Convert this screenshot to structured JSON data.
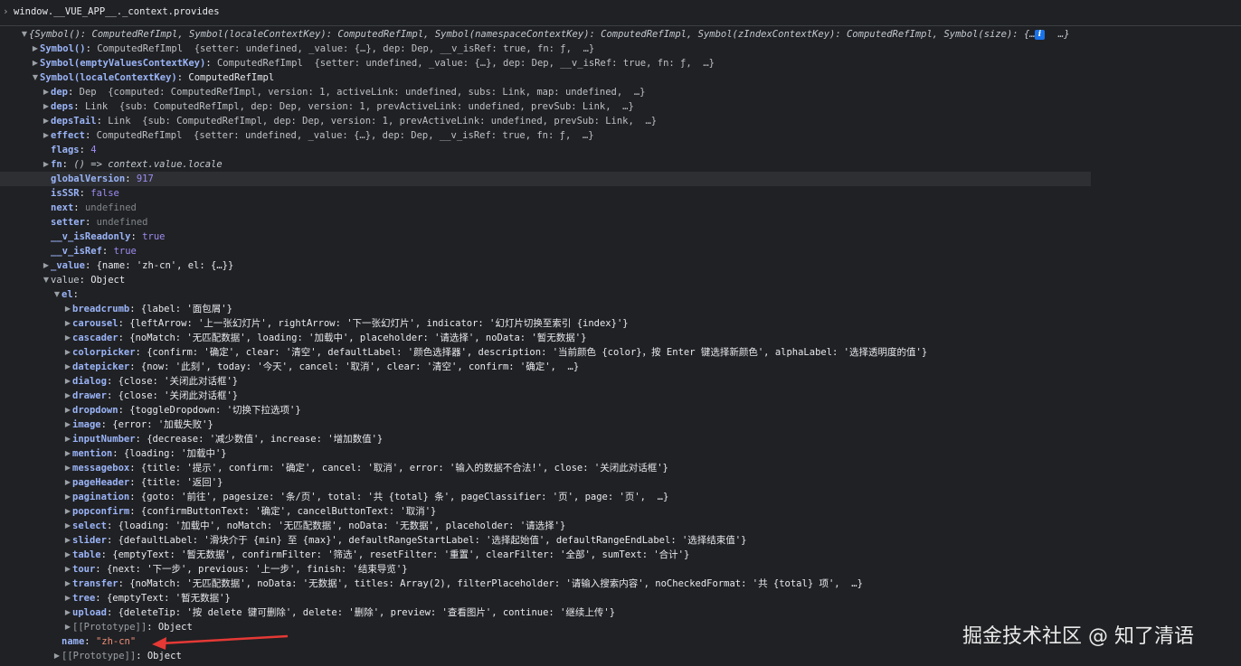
{
  "input": {
    "prompt": "›",
    "command": "window.__VUE_APP__._context.provides"
  },
  "rows": [
    {
      "d": 0,
      "t": "open",
      "k": "",
      "v": "{Symbol(): ComputedRefImpl, Symbol(localeContextKey): ComputedRefImpl, Symbol(namespaceContextKey): ComputedRefImpl, Symbol(zIndexContextKey): ComputedRefImpl, Symbol(size): {…},  …}",
      "vc": "it"
    },
    {
      "d": 1,
      "t": "closed",
      "k": "Symbol()",
      "v": "ComputedRefImpl  {setter: undefined, _value: {…}, dep: Dep, __v_isRef: true, fn: ƒ,  …}",
      "vc": "pre"
    },
    {
      "d": 1,
      "t": "closed",
      "k": "Symbol(emptyValuesContextKey)",
      "v": "ComputedRefImpl  {setter: undefined, _value: {…}, dep: Dep, __v_isRef: true, fn: ƒ,  …}",
      "vc": "pre"
    },
    {
      "d": 1,
      "t": "open",
      "k": "Symbol(localeContextKey)",
      "v": "ComputedRefImpl",
      "vc": "obj"
    },
    {
      "d": 2,
      "t": "closed",
      "k": "dep",
      "v": "Dep  {computed: ComputedRefImpl, version: 1, activeLink: undefined, subs: Link, map: undefined,  …}",
      "vc": "pre"
    },
    {
      "d": 2,
      "t": "closed",
      "k": "deps",
      "v": "Link  {sub: ComputedRefImpl, dep: Dep, version: 1, prevActiveLink: undefined, prevSub: Link,  …}",
      "vc": "pre"
    },
    {
      "d": 2,
      "t": "closed",
      "k": "depsTail",
      "v": "Link  {sub: ComputedRefImpl, dep: Dep, version: 1, prevActiveLink: undefined, prevSub: Link,  …}",
      "vc": "pre"
    },
    {
      "d": 2,
      "t": "closed",
      "k": "effect",
      "v": "ComputedRefImpl  {setter: undefined, _value: {…}, dep: Dep, __v_isRef: true, fn: ƒ,  …}",
      "vc": "pre"
    },
    {
      "d": 2,
      "t": "none",
      "k": "flags",
      "v": "4",
      "vc": "num"
    },
    {
      "d": 2,
      "t": "closed",
      "k": "fn",
      "v": "() => context.value.locale",
      "vc": "it"
    },
    {
      "d": 2,
      "t": "none",
      "k": "globalVersion",
      "v": "917",
      "vc": "num",
      "hl": true
    },
    {
      "d": 2,
      "t": "none",
      "k": "isSSR",
      "v": "false",
      "vc": "kw"
    },
    {
      "d": 2,
      "t": "none",
      "k": "next",
      "v": "undefined",
      "vc": "und"
    },
    {
      "d": 2,
      "t": "none",
      "k": "setter",
      "v": "undefined",
      "vc": "und"
    },
    {
      "d": 2,
      "t": "none",
      "k": "__v_isReadonly",
      "v": "true",
      "vc": "kw"
    },
    {
      "d": 2,
      "t": "none",
      "k": "__v_isRef",
      "v": "true",
      "vc": "kw"
    },
    {
      "d": 2,
      "t": "closed",
      "k": "_value",
      "v": "{name: 'zh-cn', el: {…}}",
      "vc": "obj"
    },
    {
      "d": 2,
      "t": "open",
      "k": "value",
      "v": "Object",
      "vc": "obj",
      "kc": "plain"
    },
    {
      "d": 3,
      "t": "open",
      "k": "el",
      "v": "",
      "vc": "obj"
    },
    {
      "d": 4,
      "t": "closed",
      "k": "breadcrumb",
      "v": "{label: '面包屑'}",
      "vc": "obj"
    },
    {
      "d": 4,
      "t": "closed",
      "k": "carousel",
      "v": "{leftArrow: '上一张幻灯片', rightArrow: '下一张幻灯片', indicator: '幻灯片切换至索引 {index}'}",
      "vc": "obj"
    },
    {
      "d": 4,
      "t": "closed",
      "k": "cascader",
      "v": "{noMatch: '无匹配数据', loading: '加载中', placeholder: '请选择', noData: '暂无数据'}",
      "vc": "obj"
    },
    {
      "d": 4,
      "t": "closed",
      "k": "colorpicker",
      "v": "{confirm: '确定', clear: '清空', defaultLabel: '颜色选择器', description: '当前颜色 {color}，按 Enter 键选择新颜色', alphaLabel: '选择透明度的值'}",
      "vc": "obj"
    },
    {
      "d": 4,
      "t": "closed",
      "k": "datepicker",
      "v": "{now: '此刻', today: '今天', cancel: '取消', clear: '清空', confirm: '确定',  …}",
      "vc": "obj"
    },
    {
      "d": 4,
      "t": "closed",
      "k": "dialog",
      "v": "{close: '关闭此对话框'}",
      "vc": "obj"
    },
    {
      "d": 4,
      "t": "closed",
      "k": "drawer",
      "v": "{close: '关闭此对话框'}",
      "vc": "obj"
    },
    {
      "d": 4,
      "t": "closed",
      "k": "dropdown",
      "v": "{toggleDropdown: '切换下拉选项'}",
      "vc": "obj"
    },
    {
      "d": 4,
      "t": "closed",
      "k": "image",
      "v": "{error: '加载失败'}",
      "vc": "obj"
    },
    {
      "d": 4,
      "t": "closed",
      "k": "inputNumber",
      "v": "{decrease: '减少数值', increase: '增加数值'}",
      "vc": "obj"
    },
    {
      "d": 4,
      "t": "closed",
      "k": "mention",
      "v": "{loading: '加载中'}",
      "vc": "obj"
    },
    {
      "d": 4,
      "t": "closed",
      "k": "messagebox",
      "v": "{title: '提示', confirm: '确定', cancel: '取消', error: '输入的数据不合法!', close: '关闭此对话框'}",
      "vc": "obj"
    },
    {
      "d": 4,
      "t": "closed",
      "k": "pageHeader",
      "v": "{title: '返回'}",
      "vc": "obj"
    },
    {
      "d": 4,
      "t": "closed",
      "k": "pagination",
      "v": "{goto: '前往', pagesize: '条/页', total: '共 {total} 条', pageClassifier: '页', page: '页',  …}",
      "vc": "obj"
    },
    {
      "d": 4,
      "t": "closed",
      "k": "popconfirm",
      "v": "{confirmButtonText: '确定', cancelButtonText: '取消'}",
      "vc": "obj"
    },
    {
      "d": 4,
      "t": "closed",
      "k": "select",
      "v": "{loading: '加载中', noMatch: '无匹配数据', noData: '无数据', placeholder: '请选择'}",
      "vc": "obj"
    },
    {
      "d": 4,
      "t": "closed",
      "k": "slider",
      "v": "{defaultLabel: '滑块介于 {min} 至 {max}', defaultRangeStartLabel: '选择起始值', defaultRangeEndLabel: '选择结束值'}",
      "vc": "obj"
    },
    {
      "d": 4,
      "t": "closed",
      "k": "table",
      "v": "{emptyText: '暂无数据', confirmFilter: '筛选', resetFilter: '重置', clearFilter: '全部', sumText: '合计'}",
      "vc": "obj"
    },
    {
      "d": 4,
      "t": "closed",
      "k": "tour",
      "v": "{next: '下一步', previous: '上一步', finish: '结束导览'}",
      "vc": "obj"
    },
    {
      "d": 4,
      "t": "closed",
      "k": "transfer",
      "v": "{noMatch: '无匹配数据', noData: '无数据', titles: Array(2), filterPlaceholder: '请输入搜索内容', noCheckedFormat: '共 {total} 项',  …}",
      "vc": "obj"
    },
    {
      "d": 4,
      "t": "closed",
      "k": "tree",
      "v": "{emptyText: '暂无数据'}",
      "vc": "obj"
    },
    {
      "d": 4,
      "t": "closed",
      "k": "upload",
      "v": "{deleteTip: '按 delete 键可删除', delete: '删除', preview: '查看图片', continue: '继续上传'}",
      "vc": "obj"
    },
    {
      "d": 4,
      "t": "closed",
      "k": "[[Prototype]]",
      "v": "Object",
      "vc": "obj",
      "kc": "dim"
    },
    {
      "d": 3,
      "t": "none",
      "k": "name",
      "v": "\"zh-cn\"",
      "vc": "str"
    },
    {
      "d": 3,
      "t": "closed",
      "k": "[[Prototype]]",
      "v": "Object",
      "vc": "obj",
      "kc": "dim"
    }
  ],
  "watermark": "掘金技术社区 @ 知了清语",
  "colors": {
    "background": "#202124",
    "key": "#9ab4f8",
    "string": "#ee8f78",
    "number": "#9e8cf2",
    "arrow": "#e53935"
  }
}
